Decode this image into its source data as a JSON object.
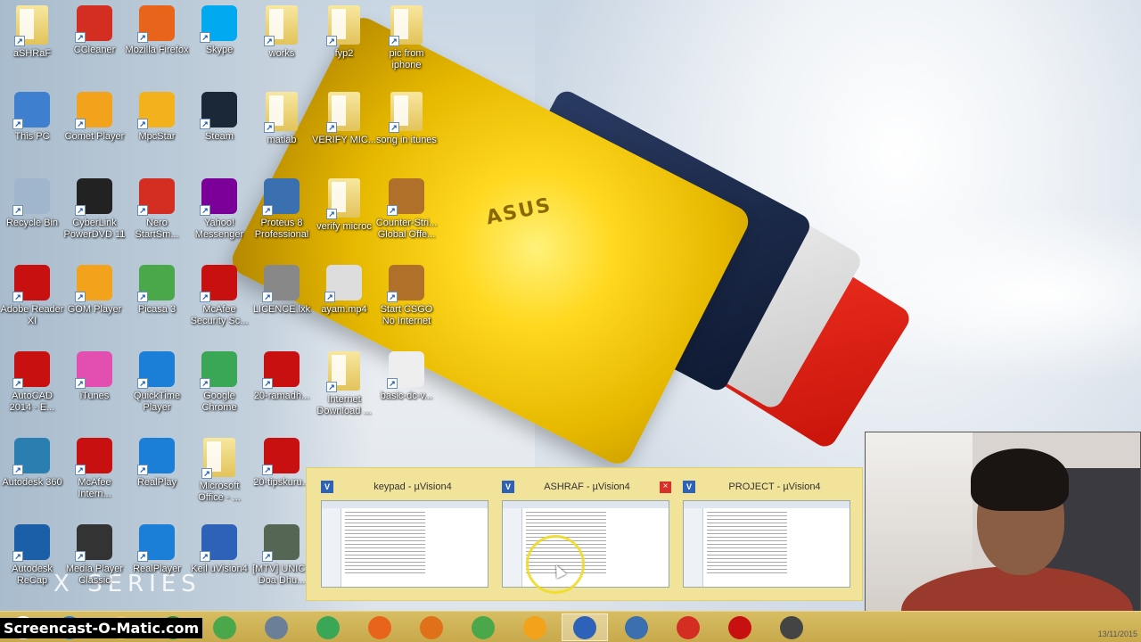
{
  "desktop_icons": [
    {
      "label": "aSHRaF",
      "icon": "user-folder-icon",
      "color": "#e8c65a"
    },
    {
      "label": "CCleaner",
      "icon": "ccleaner-icon",
      "color": "#d42e23"
    },
    {
      "label": "Mozilla Firefox",
      "icon": "firefox-icon",
      "color": "#e8641b"
    },
    {
      "label": "Skype",
      "icon": "skype-icon",
      "color": "#00a9f0"
    },
    {
      "label": "works",
      "icon": "folder-icon",
      "color": "#e8c65a"
    },
    {
      "label": "fyp2",
      "icon": "folder-icon",
      "color": "#e8c65a"
    },
    {
      "label": "pic from iphone",
      "icon": "folder-icon",
      "color": "#e8c65a"
    },
    {
      "label": "This PC",
      "icon": "computer-icon",
      "color": "#3f7fd0"
    },
    {
      "label": "Comet Player",
      "icon": "comet-icon",
      "color": "#f3a21b"
    },
    {
      "label": "MpcStar",
      "icon": "mpcstar-icon",
      "color": "#f3b21b"
    },
    {
      "label": "Steam",
      "icon": "steam-icon",
      "color": "#1b2838"
    },
    {
      "label": "matlab",
      "icon": "folder-icon",
      "color": "#e8c65a"
    },
    {
      "label": "VERIFY MIC...",
      "icon": "folder-icon",
      "color": "#e8c65a"
    },
    {
      "label": "song in itunes",
      "icon": "folder-icon",
      "color": "#e8c65a"
    },
    {
      "label": "Recycle Bin",
      "icon": "recycle-bin-icon",
      "color": "#9fb6cc"
    },
    {
      "label": "CyberLink PowerDVD 11",
      "icon": "powerdvd-icon",
      "color": "#222222"
    },
    {
      "label": "Nero StartSm...",
      "icon": "nero-icon",
      "color": "#d42e23"
    },
    {
      "label": "Yahoo! Messenger",
      "icon": "yahoo-messenger-icon",
      "color": "#7b0099"
    },
    {
      "label": "Proteus 8 Professional",
      "icon": "proteus-icon",
      "color": "#3a6fb0"
    },
    {
      "label": "verify microc",
      "icon": "folder-icon",
      "color": "#e8c65a"
    },
    {
      "label": "Counter-Stri... Global Offe...",
      "icon": "csgo-icon",
      "color": "#b0702a"
    },
    {
      "label": "Adobe Reader XI",
      "icon": "adobe-reader-icon",
      "color": "#c81010"
    },
    {
      "label": "GOM Player",
      "icon": "gom-player-icon",
      "color": "#f3a21b"
    },
    {
      "label": "Picasa 3",
      "icon": "picasa-icon",
      "color": "#4aa84a"
    },
    {
      "label": "McAfee Security Sc...",
      "icon": "mcafee-icon",
      "color": "#c81010"
    },
    {
      "label": "LICENCE.lxk",
      "icon": "lock-file-icon",
      "color": "#888888"
    },
    {
      "label": "ayam.mp4",
      "icon": "video-file-icon",
      "color": "#dddddd"
    },
    {
      "label": "Start CSGO No Internet",
      "icon": "csgo-icon",
      "color": "#b0702a"
    },
    {
      "label": "AutoCAD 2014 - E...",
      "icon": "autocad-icon",
      "color": "#c81010"
    },
    {
      "label": "iTunes",
      "icon": "itunes-icon",
      "color": "#e24fb1"
    },
    {
      "label": "QuickTime Player",
      "icon": "quicktime-icon",
      "color": "#1b7fd8"
    },
    {
      "label": "Google Chrome",
      "icon": "chrome-icon",
      "color": "#3aa757"
    },
    {
      "label": "20-ramadh...",
      "icon": "pdf-file-icon",
      "color": "#c81010"
    },
    {
      "label": "Internet Download ...",
      "icon": "folder-icon",
      "color": "#e8c65a"
    },
    {
      "label": "basic-dc-v...",
      "icon": "document-icon",
      "color": "#eeeeee"
    },
    {
      "label": "Autodesk 360",
      "icon": "autodesk360-icon",
      "color": "#2a7fb0"
    },
    {
      "label": "McAfee Intern...",
      "icon": "mcafee-icon",
      "color": "#c81010"
    },
    {
      "label": "RealPlay",
      "icon": "realplay-icon",
      "color": "#1b7fd8"
    },
    {
      "label": "Microsoft Office - ...",
      "icon": "folder-icon",
      "color": "#e8c65a"
    },
    {
      "label": "20-tipskuru...",
      "icon": "pdf-file-icon",
      "color": "#c81010"
    },
    {
      "label": "Autodesk ReCap",
      "icon": "recap-icon",
      "color": "#1b5fa8"
    },
    {
      "label": "Media Player Classic",
      "icon": "mpc-icon",
      "color": "#333333"
    },
    {
      "label": "RealPlayer",
      "icon": "realplayer-icon",
      "color": "#1b7fd8"
    },
    {
      "label": "Keil uVision4",
      "icon": "keil-icon",
      "color": "#2e62b8"
    },
    {
      "label": "[MTV] UNIC - Doa Dhu...",
      "icon": "video-file-icon",
      "color": "#556655"
    }
  ],
  "wallpaper": {
    "brand": "ASUS",
    "series_text": "X SERIES"
  },
  "taskbar": {
    "items": [
      {
        "icon": "windows-start-icon",
        "color": "#ffffff"
      },
      {
        "icon": "internet-explorer-icon",
        "color": "#1b7fd8"
      },
      {
        "icon": "file-explorer-icon",
        "color": "#e8c65a"
      },
      {
        "icon": "store-icon",
        "color": "#1f8a3a"
      },
      {
        "icon": "picasa-icon",
        "color": "#4aa84a"
      },
      {
        "icon": "control-panel-icon",
        "color": "#6b7f99"
      },
      {
        "icon": "chrome-icon",
        "color": "#3aa757"
      },
      {
        "icon": "firefox-icon",
        "color": "#e8641b"
      },
      {
        "icon": "matlab-icon",
        "color": "#e0701a"
      },
      {
        "icon": "utorrent-icon",
        "color": "#4aa84a"
      },
      {
        "icon": "gom-player-icon",
        "color": "#f3a21b"
      },
      {
        "icon": "keil-icon",
        "color": "#2e62b8"
      },
      {
        "icon": "proteus-icon",
        "color": "#3a6fb0"
      },
      {
        "icon": "opera-icon",
        "color": "#d42e23"
      },
      {
        "icon": "mcafee-icon",
        "color": "#c81010"
      },
      {
        "icon": "screen-capture-icon",
        "color": "#444444"
      }
    ],
    "watermark": "Screencast-O-Matic.com",
    "clock": "13/11/2015"
  },
  "thumbnails": [
    {
      "title": "keypad - µVision4",
      "close": ""
    },
    {
      "title": "ASHRAF - µVision4",
      "close": "×"
    },
    {
      "title": "PROJECT - µVision4",
      "close": ""
    }
  ]
}
